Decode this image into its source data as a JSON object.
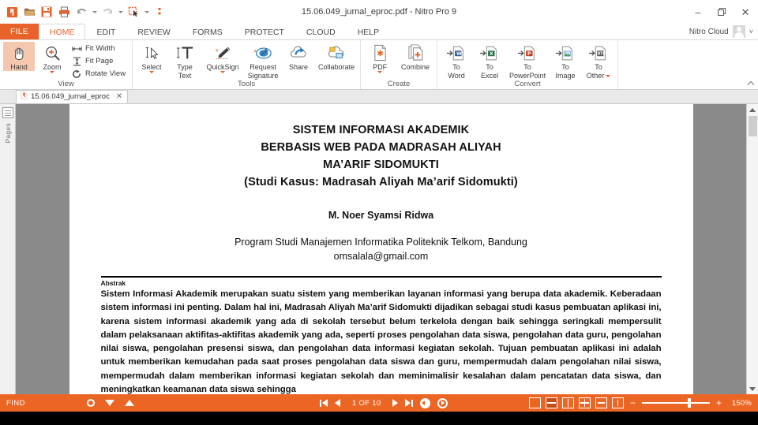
{
  "window": {
    "title": "15.06.049_jurnal_eproc.pdf - Nitro Pro 9",
    "minimize": "–",
    "restore": "❐",
    "close": "✕"
  },
  "quick_access": {
    "app_logo": "nitro-logo-icon",
    "buttons": [
      "open-icon",
      "save-icon",
      "print-icon",
      "undo-icon",
      "redo-icon",
      "select-tool-icon",
      "customize-icon"
    ]
  },
  "ribbon": {
    "file_tab": "FILE",
    "tabs": [
      {
        "label": "HOME",
        "active": true
      },
      {
        "label": "EDIT",
        "active": false
      },
      {
        "label": "REVIEW",
        "active": false
      },
      {
        "label": "FORMS",
        "active": false
      },
      {
        "label": "PROTECT",
        "active": false
      },
      {
        "label": "CLOUD",
        "active": false
      },
      {
        "label": "HELP",
        "active": false
      }
    ],
    "account": {
      "label": "Nitro Cloud",
      "avatar": "user-avatar",
      "chevron": "˅"
    },
    "groups": [
      {
        "name": "View",
        "label": "View",
        "big_buttons": [
          {
            "label": "Hand",
            "icon": "hand-icon",
            "selected": true,
            "dropdown": false
          },
          {
            "label": "Zoom",
            "icon": "zoom-magnifier-icon",
            "selected": false,
            "dropdown": true
          }
        ],
        "small_buttons": [
          {
            "label": "Fit Width",
            "icon": "fit-width-icon"
          },
          {
            "label": "Fit Page",
            "icon": "fit-page-icon"
          },
          {
            "label": "Rotate View",
            "icon": "rotate-view-icon"
          }
        ]
      },
      {
        "name": "Tools",
        "label": "Tools",
        "big_buttons": [
          {
            "label": "Select",
            "icon": "select-cursor-icon",
            "selected": false,
            "dropdown": true
          },
          {
            "label": "Type\nText",
            "line1": "Type",
            "line2": "Text",
            "icon": "type-text-icon",
            "selected": false,
            "dropdown": false
          },
          {
            "label": "QuickSign",
            "icon": "quicksign-pen-icon",
            "selected": false,
            "dropdown": true
          },
          {
            "label": "Request Signature",
            "line1": "Request",
            "line2": "Signature",
            "icon": "request-signature-icon",
            "selected": false,
            "dropdown": false
          },
          {
            "label": "Share",
            "icon": "share-cloud-icon",
            "selected": false,
            "dropdown": false
          },
          {
            "label": "Collaborate",
            "icon": "collaborate-cloud-icon",
            "selected": false,
            "dropdown": false
          }
        ]
      },
      {
        "name": "Create",
        "label": "Create",
        "big_buttons": [
          {
            "label": "PDF",
            "icon": "create-pdf-icon",
            "selected": false,
            "dropdown": true
          },
          {
            "label": "Combine",
            "icon": "combine-icon",
            "selected": false,
            "dropdown": false
          }
        ]
      },
      {
        "name": "Convert",
        "label": "Convert",
        "big_buttons": [
          {
            "label": "To Word",
            "line1": "To",
            "line2": "Word",
            "icon": "to-word-icon",
            "selected": false,
            "dropdown": false
          },
          {
            "label": "To Excel",
            "line1": "To",
            "line2": "Excel",
            "icon": "to-excel-icon",
            "selected": false,
            "dropdown": false
          },
          {
            "label": "To PowerPoint",
            "line1": "To",
            "line2": "PowerPoint",
            "icon": "to-powerpoint-icon",
            "selected": false,
            "dropdown": false
          },
          {
            "label": "To Image",
            "line1": "To",
            "line2": "Image",
            "icon": "to-image-icon",
            "selected": false,
            "dropdown": false
          },
          {
            "label": "To Other",
            "line1": "To",
            "line2": "Other",
            "icon": "to-other-icon",
            "selected": false,
            "dropdown": true
          }
        ]
      }
    ]
  },
  "document_tabs": [
    {
      "label": "15.06.049_jurnal_eproc",
      "icon": "pdf-file-icon",
      "close": "✕",
      "active": true
    }
  ],
  "side_panel": {
    "pages_label": "Pages",
    "icon": "pages-panel-icon"
  },
  "document": {
    "title_lines": [
      "SISTEM INFORMASI AKADEMIK",
      "BERBASIS WEB PADA MADRASAH ALIYAH",
      "MA’ARIF SIDOMUKTI",
      "(Studi Kasus: Madrasah Aliyah Ma’arif Sidomukti)"
    ],
    "author": "M. Noer Syamsi Ridwa",
    "affiliation": "Program Studi Manajemen Informatika Politeknik Telkom, Bandung",
    "email": "omsalala@gmail.com",
    "abstract_heading": "Abstrak",
    "abstract_body": "Sistem Informasi Akademik merupakan suatu sistem yang memberikan layanan informasi yang berupa data akademik. Keberadaan sistem informasi ini penting. Dalam hal ini, Madrasah Aliyah Ma’arif Sidomukti dijadikan sebagai studi kasus pembuatan aplikasi ini, karena sistem informasi akademik yang ada di sekolah tersebut belum terkelola dengan baik sehingga seringkali mempersulit dalam pelaksanaan aktifitas-aktifitas akademik yang ada, seperti proses pengolahan data siswa, pengolahan data guru, pengolahan nilai siswa, pengolahan presensi siswa, dan pengolahan data informasi kegiatan sekolah. Tujuan pembuatan aplikasi ini adalah untuk memberikan kemudahan pada saat proses pengolahan data siswa dan guru, mempermudah dalam pengolahan nilai siswa, mempermudah dalam memberikan informasi kegiatan sekolah dan meminimalisir kesalahan dalam pencatatan data siswa, dan meningkatkan keamanan data siswa sehingga"
  },
  "status_bar": {
    "find_label": "FIND",
    "find_settings_icon": "gear-icon",
    "find_next_icon": "find-next-icon",
    "find_prev_icon": "find-previous-icon",
    "first_page_icon": "first-page-icon",
    "prev_page_icon": "previous-page-icon",
    "page_indicator": "1 OF 10",
    "next_page_icon": "next-page-icon",
    "last_page_icon": "last-page-icon",
    "rotate_left_icon": "rotate-left-icon",
    "rotate_right_icon": "rotate-right-icon",
    "view_modes": [
      {
        "name": "single-page-view",
        "active": false
      },
      {
        "name": "continuous-page-view",
        "active": true
      },
      {
        "name": "two-page-view",
        "active": false
      },
      {
        "name": "two-page-continuous-view",
        "active": false
      },
      {
        "name": "fit-page-view",
        "active": false
      },
      {
        "name": "full-screen-view",
        "active": false
      }
    ],
    "zoom_out": "−",
    "zoom_in": "+",
    "zoom_level": "150%"
  },
  "colors": {
    "accent_orange": "#eb6624",
    "file_tab_orange": "#e8622a",
    "page_background": "#8a8a8a"
  }
}
